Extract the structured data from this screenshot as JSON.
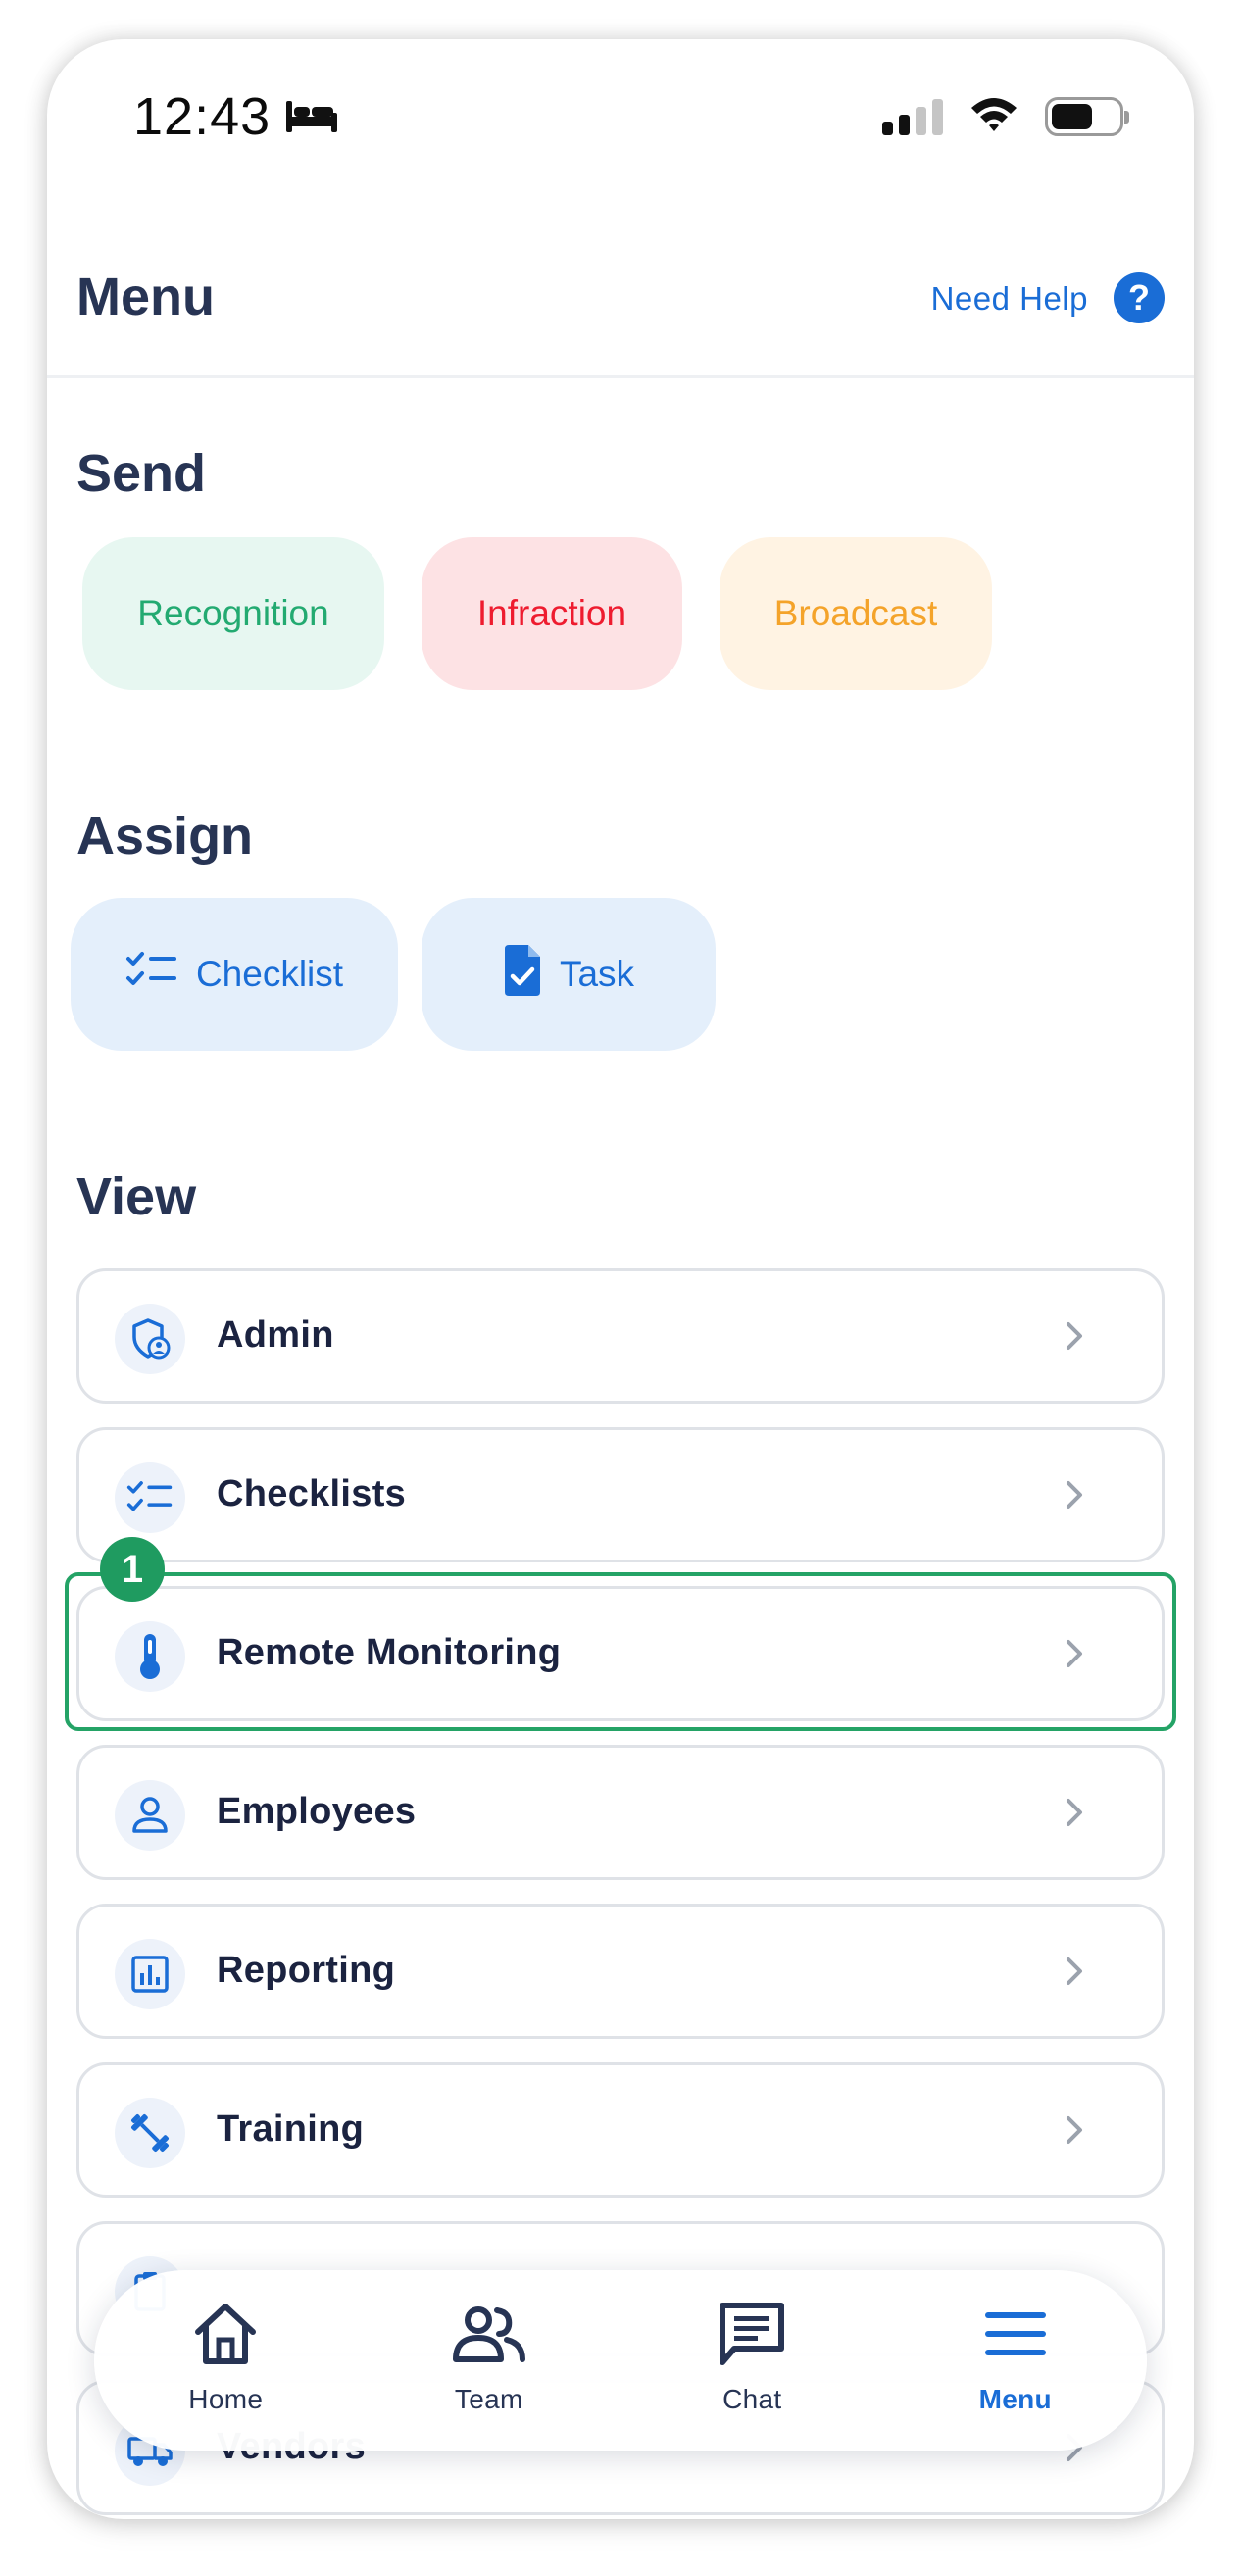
{
  "status_bar": {
    "time": "12:43"
  },
  "header": {
    "title": "Menu",
    "help_label": "Need Help",
    "help_icon_glyph": "?"
  },
  "sections": {
    "send": {
      "title": "Send",
      "buttons": [
        {
          "label": "Recognition",
          "color": "#23aa71"
        },
        {
          "label": "Infraction",
          "color": "#ee1c2f"
        },
        {
          "label": "Broadcast",
          "color": "#f4a32a"
        }
      ]
    },
    "assign": {
      "title": "Assign",
      "buttons": [
        {
          "label": "Checklist",
          "icon": "checklist-icon"
        },
        {
          "label": "Task",
          "icon": "task-document-icon"
        }
      ]
    },
    "view": {
      "title": "View",
      "items": [
        {
          "label": "Admin",
          "icon": "admin-shield-icon"
        },
        {
          "label": "Checklists",
          "icon": "checklist-icon"
        },
        {
          "label": "Remote Monitoring",
          "icon": "thermometer-icon"
        },
        {
          "label": "Employees",
          "icon": "person-icon"
        },
        {
          "label": "Reporting",
          "icon": "bar-chart-icon"
        },
        {
          "label": "Training",
          "icon": "dumbbell-icon"
        },
        {
          "label": "",
          "icon": "clipboard-icon"
        },
        {
          "label": "Vendors",
          "icon": "truck-icon"
        }
      ]
    }
  },
  "annotation": {
    "badge_number": "1",
    "color": "#24a366"
  },
  "tab_bar": {
    "tabs": [
      {
        "label": "Home",
        "icon": "home-icon"
      },
      {
        "label": "Team",
        "icon": "team-icon"
      },
      {
        "label": "Chat",
        "icon": "chat-icon"
      },
      {
        "label": "Menu",
        "icon": "menu-icon",
        "active": true
      }
    ]
  },
  "colors": {
    "primary": "#1a6dd6",
    "heading": "#273454"
  }
}
